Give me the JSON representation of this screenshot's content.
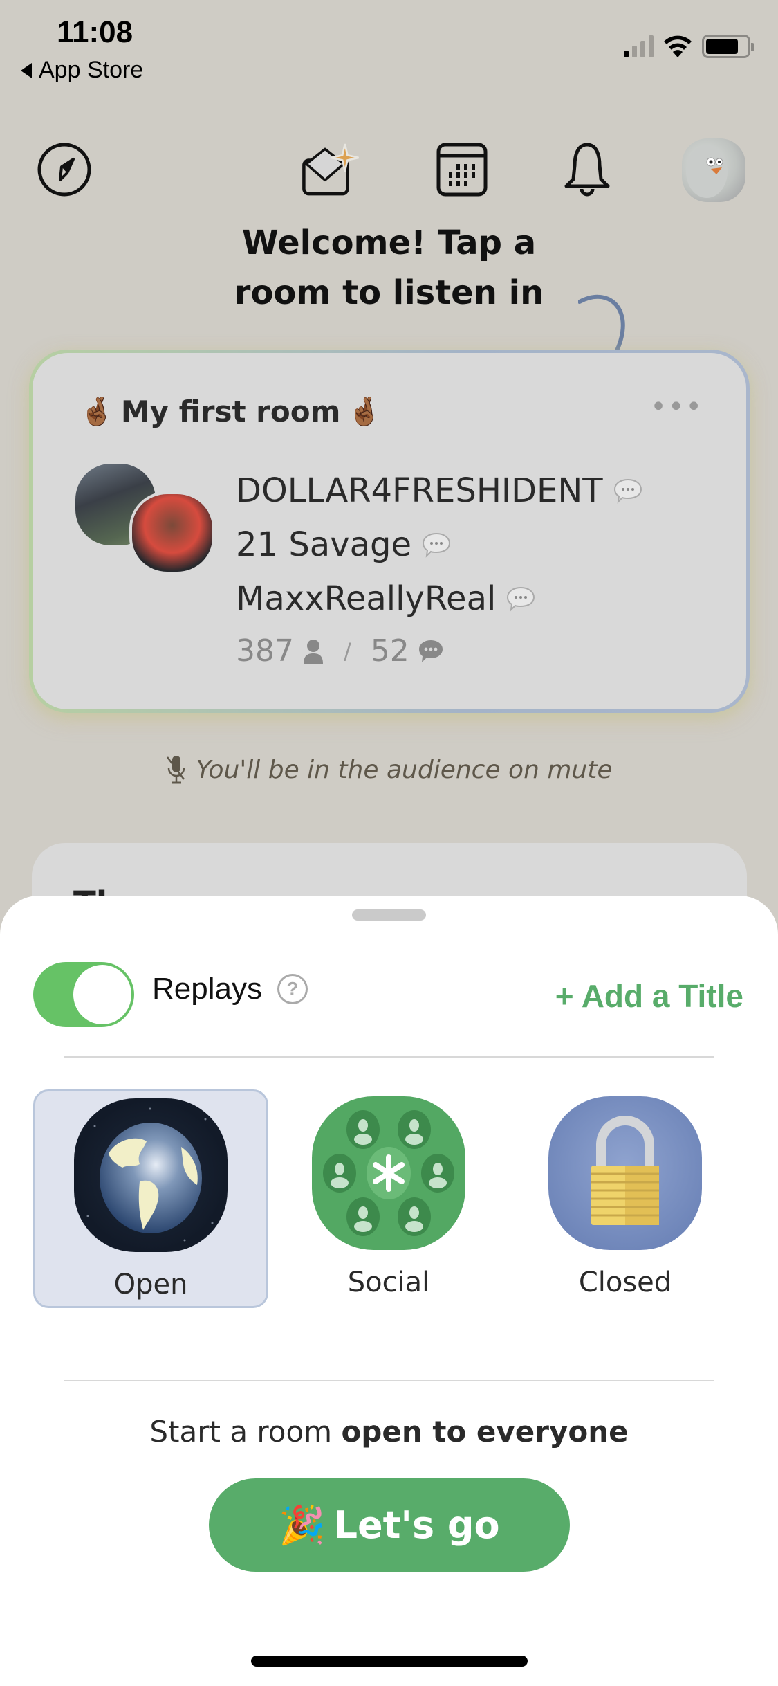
{
  "status_bar": {
    "time": "11:08",
    "back_label": "App Store",
    "signal_bars_on": 1,
    "signal_bars_total": 4,
    "battery_level": 0.8
  },
  "nav": {
    "icons": [
      "compass-icon",
      "invite-envelope-icon",
      "calendar-icon",
      "bell-icon",
      "profile-avatar"
    ]
  },
  "welcome": {
    "line1": "Welcome! Tap a",
    "line2": "room to listen in"
  },
  "room": {
    "title_emoji": "🤞🏾",
    "title": "My first room",
    "speakers": [
      {
        "name": "DOLLAR4FRESHIDENT"
      },
      {
        "name": "21 Savage"
      },
      {
        "name": "MaxxReallyReal"
      }
    ],
    "listener_count": "387",
    "chat_count": "52",
    "more_label": "•••"
  },
  "mute_note": "You'll be in the audience on mute",
  "next_card_text": "The",
  "sheet": {
    "replays_label": "Replays",
    "replays_enabled": true,
    "help_label": "?",
    "add_title_label": "+ Add a Title",
    "room_types": [
      {
        "label": "Open",
        "selected": true
      },
      {
        "label": "Social",
        "selected": false
      },
      {
        "label": "Closed",
        "selected": false
      }
    ],
    "start_prefix": "Start a room ",
    "start_emphasis": "open to everyone",
    "cta_emoji": "🎉",
    "cta_label": "Let's go"
  },
  "colors": {
    "accent_green": "#58ac6a",
    "toggle_green": "#66c266",
    "background": "#cfccc5",
    "card": "#d9d9d9",
    "selected_bg": "#dfe3ee"
  }
}
